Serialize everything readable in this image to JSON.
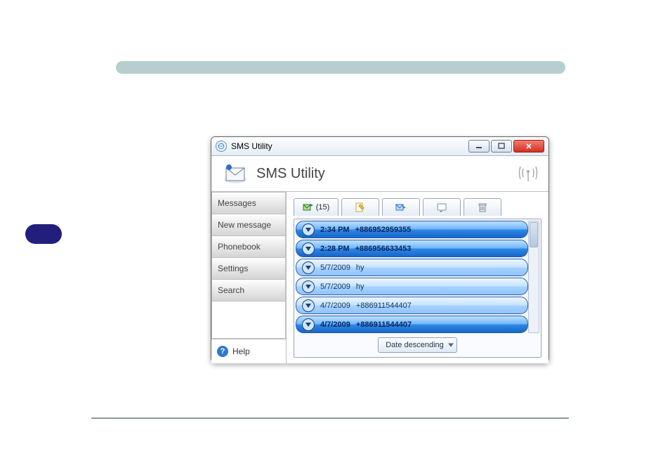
{
  "window": {
    "title": "SMS Utility",
    "app_title": "SMS Utility"
  },
  "sidebar": {
    "items": [
      {
        "label": "Messages"
      },
      {
        "label": "New message"
      },
      {
        "label": "Phonebook"
      },
      {
        "label": "Settings"
      },
      {
        "label": "Search"
      }
    ],
    "help": "Help"
  },
  "toolbar": {
    "inbox_count": "(15)"
  },
  "messages": [
    {
      "time": "2:34 PM",
      "from": "+886952959355",
      "unread": true
    },
    {
      "time": "2:28 PM",
      "from": "+886956633453",
      "unread": true
    },
    {
      "time": "5/7/2009",
      "from": "hy",
      "unread": false
    },
    {
      "time": "5/7/2009",
      "from": "hy",
      "unread": false
    },
    {
      "time": "4/7/2009",
      "from": "+886911544407",
      "unread": false
    },
    {
      "time": "4/7/2009",
      "from": "+886911544407",
      "unread": true
    }
  ],
  "sort": {
    "selected": "Date descending"
  }
}
